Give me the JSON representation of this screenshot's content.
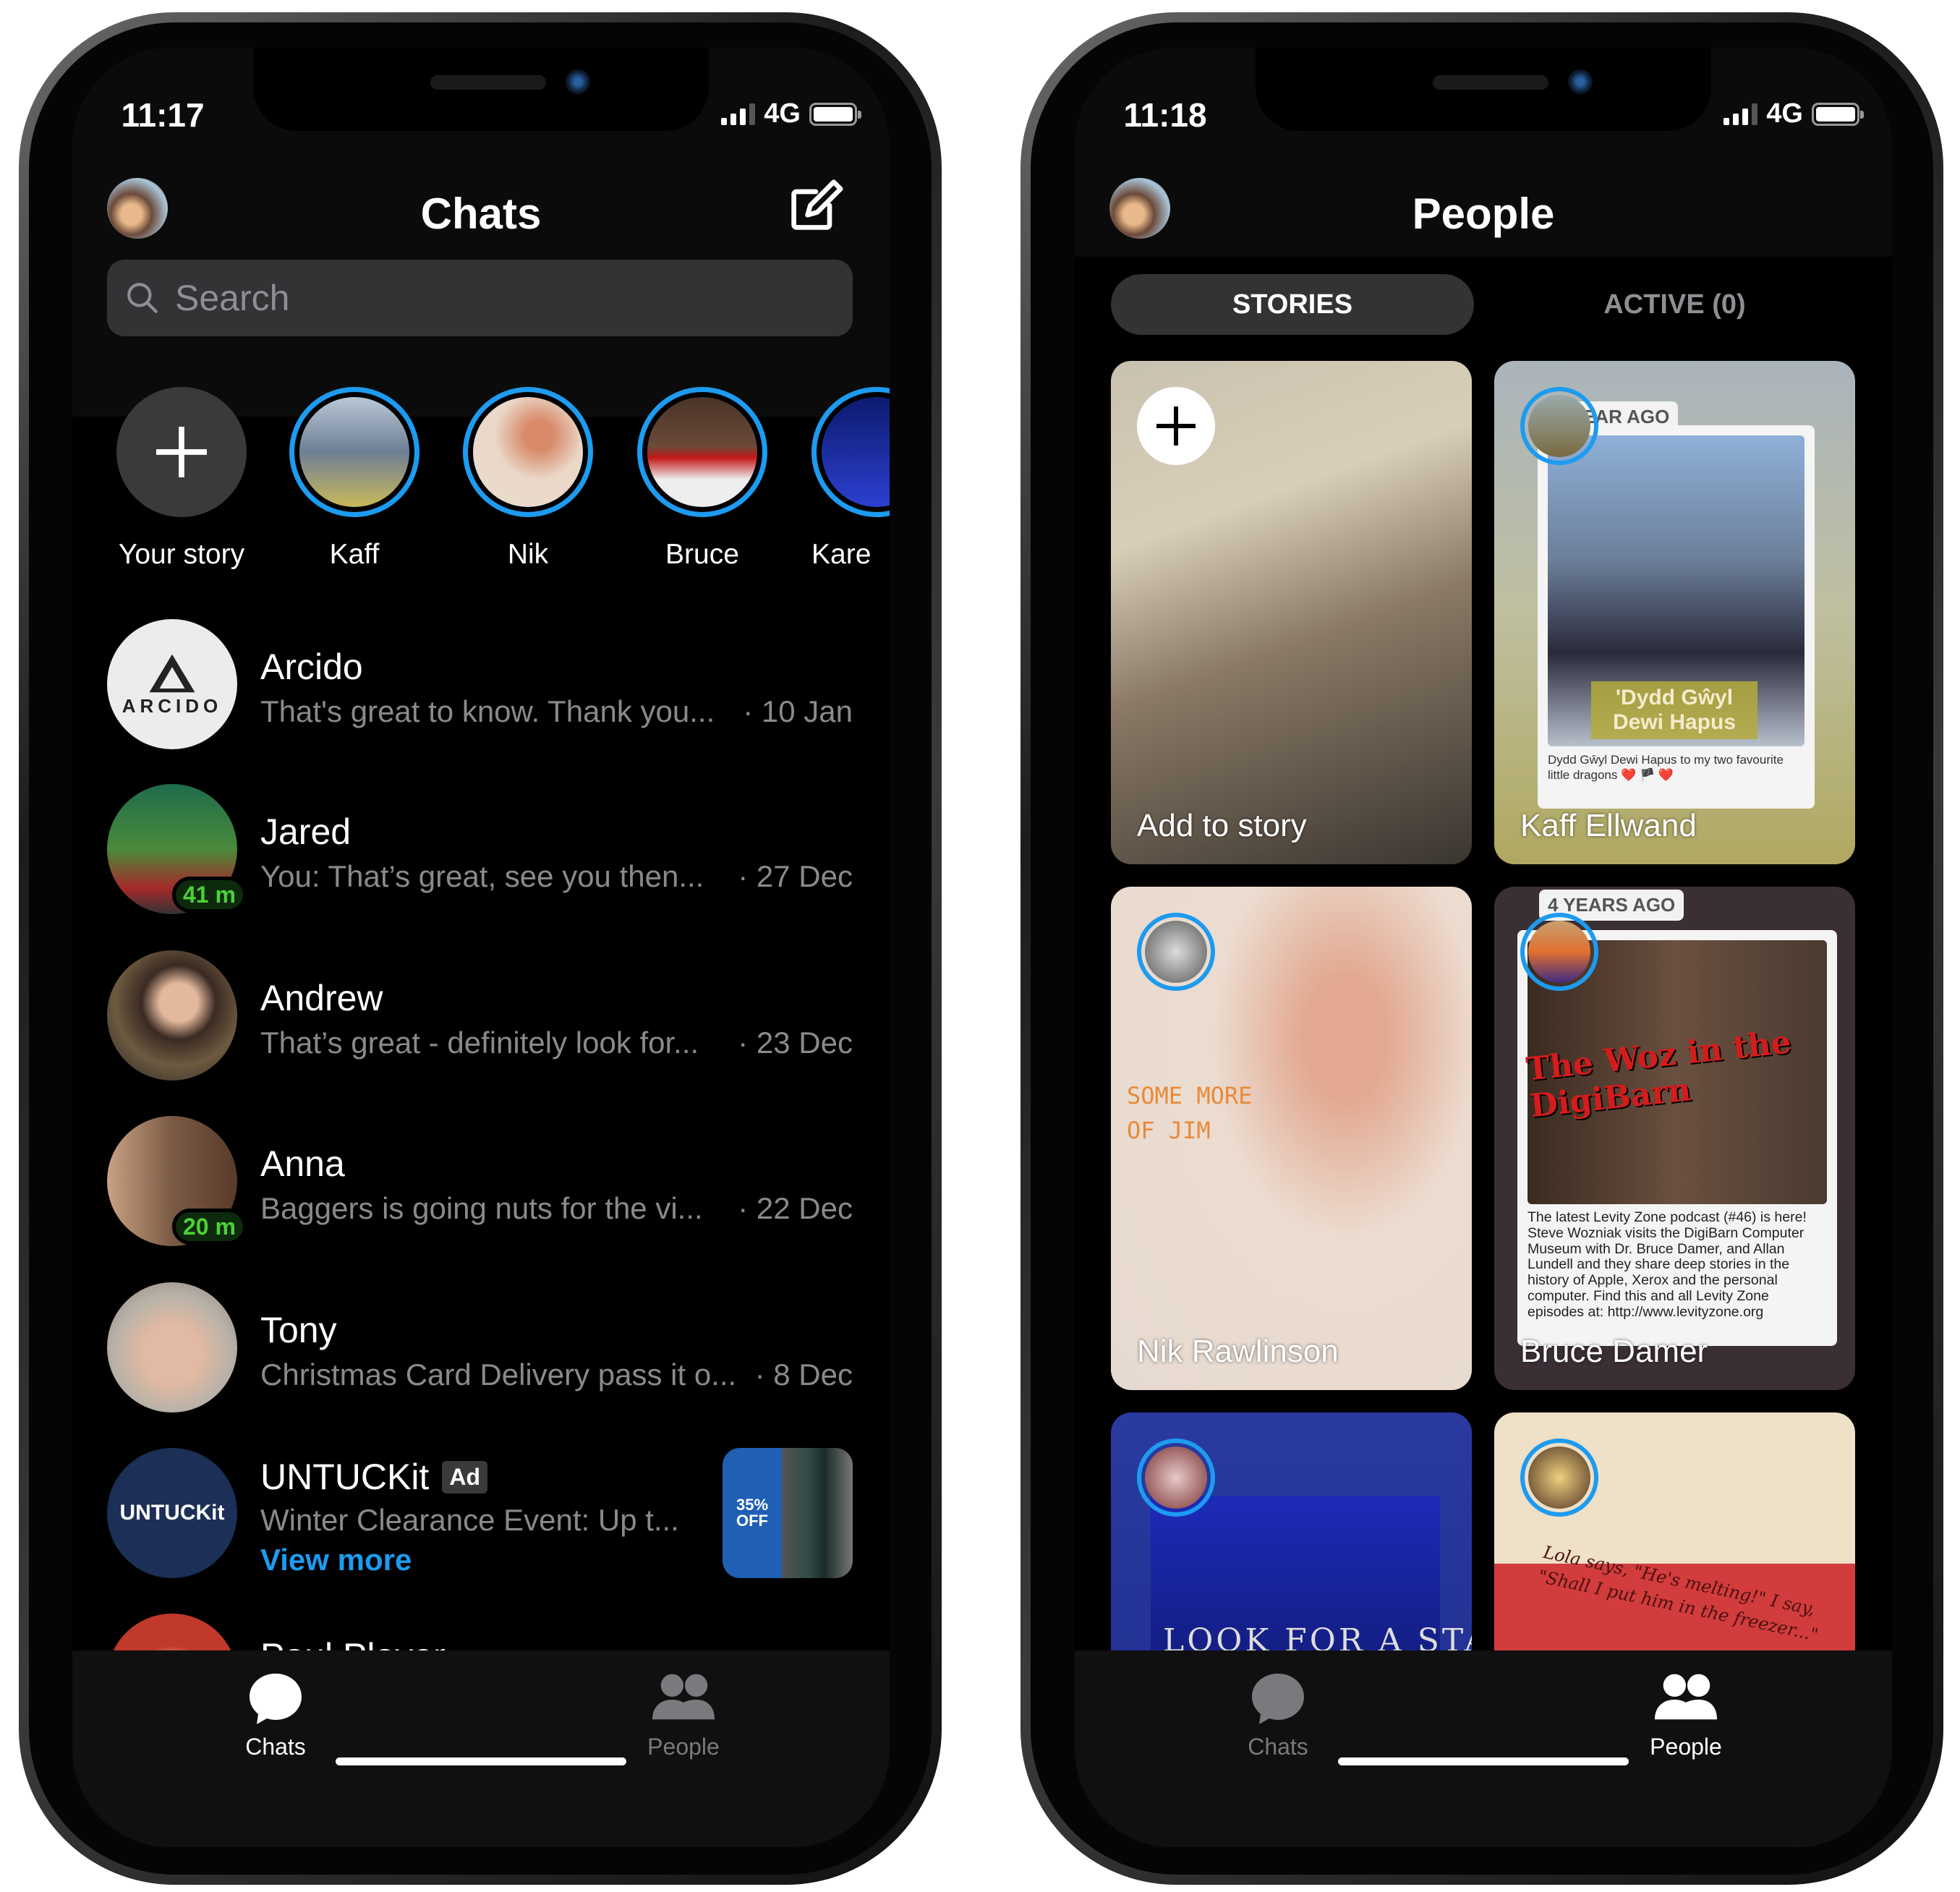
{
  "left_phone": {
    "status": {
      "time": "11:17",
      "network": "4G"
    },
    "header": {
      "title": "Chats"
    },
    "search": {
      "placeholder": "Search"
    },
    "stories": [
      {
        "label": "Your story"
      },
      {
        "label": "Kaff"
      },
      {
        "label": "Nik"
      },
      {
        "label": "Bruce"
      },
      {
        "label": "Kare"
      }
    ],
    "chats": [
      {
        "name": "Arcido",
        "preview": "That's great to know. Thank you...",
        "date": "· 10 Jan",
        "avatar_text": "ARCIDO"
      },
      {
        "name": "Jared",
        "preview": "You: That’s great, see you then...",
        "date": "· 27 Dec",
        "presence": "41 m"
      },
      {
        "name": "Andrew",
        "preview": "That’s great - definitely look for...",
        "date": "· 23 Dec"
      },
      {
        "name": "Anna",
        "preview": "Baggers is going nuts for the vi...",
        "date": "· 22 Dec",
        "presence": "20 m"
      },
      {
        "name": "Tony",
        "preview": "Christmas Card Delivery pass it o...",
        "date": "· 8 Dec"
      },
      {
        "name": "UNTUCKit",
        "badge": "Ad",
        "preview": "Winter Clearance Event: Up t...",
        "link": "View more",
        "avatar_text": "UNTUCKit",
        "thumb_text": "35% OFF"
      },
      {
        "name": "Paul Player"
      }
    ],
    "tabs": [
      {
        "label": "Chats",
        "active": true
      },
      {
        "label": "People",
        "active": false
      }
    ]
  },
  "right_phone": {
    "status": {
      "time": "11:18",
      "network": "4G"
    },
    "header": {
      "title": "People"
    },
    "segments": [
      {
        "label": "STORIES",
        "active": true
      },
      {
        "label": "ACTIVE (0)",
        "active": false
      }
    ],
    "story_cards": [
      {
        "name": "Add to story"
      },
      {
        "name": "Kaff Ellwand",
        "ago": "EAR AGO",
        "headline": "'Dydd Gŵyl Dewi Hapus",
        "caption": "Dydd Gŵyl Dewi Hapus to my two favourite little dragons ❤️ 🏴 ❤️"
      },
      {
        "name": "Nik Rawlinson",
        "art_text": "SOME MORE OF JIM"
      },
      {
        "name": "Bruce Damer",
        "ago": "4 YEARS AGO",
        "headline": "The Woz in the DigiBarn",
        "caption": "The latest Levity Zone podcast (#46) is here! Steve Wozniak visits the DigiBarn Computer Museum with Dr. Bruce Damer, and Allan Lundell and they share deep stories in the history of Apple, Xerox and the personal computer. Find this and all Levity Zone episodes at: http://www.levityzone.org"
      },
      {
        "art_text": "LOOK FOR A STAR"
      },
      {
        "art_text": "Lola says, \"He's melting!\" I say, \"Shall I put him in the freezer...\""
      }
    ],
    "tabs": [
      {
        "label": "Chats",
        "active": false
      },
      {
        "label": "People",
        "active": true
      }
    ]
  },
  "colors": {
    "accent": "#1d9bf0",
    "presence": "#4cd137",
    "background": "#000000",
    "search_bg": "#333336"
  }
}
